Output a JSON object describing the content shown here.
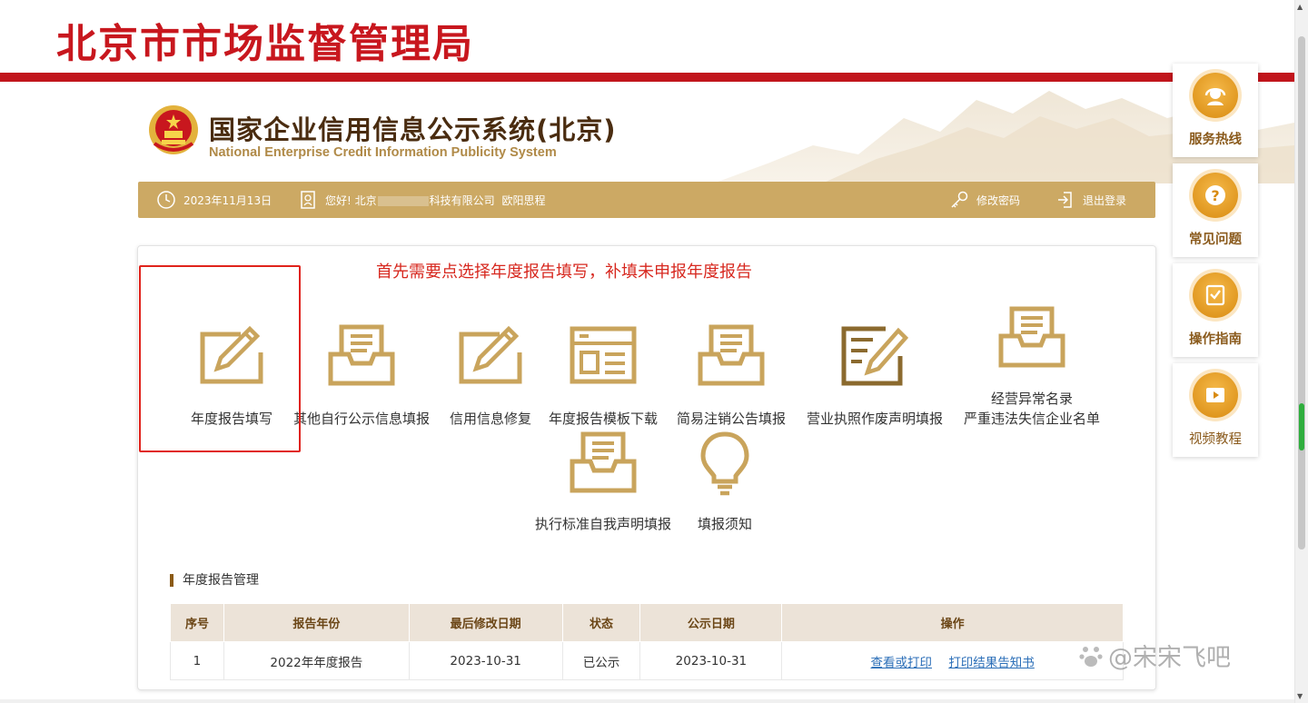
{
  "bureau": {
    "title": "北京市市场监督管理局"
  },
  "system": {
    "title": "国家企业信用信息公示系统(北京)",
    "subtitle": "National Enterprise Credit Information Publicity System"
  },
  "navbar": {
    "date": "2023年11月13日",
    "greeting": "您好!",
    "company": "北京",
    "company_suffix": "科技有限公司",
    "user": "欧阳思程",
    "change_password": "修改密码",
    "logout": "退出登录"
  },
  "instruction": "首先需要点选择年度报告填写，补填未申报年度报告",
  "tiles": [
    {
      "label": "年度报告填写",
      "icon": "edit-icon"
    },
    {
      "label": "其他自行公示信息填报",
      "icon": "inbox-doc-icon"
    },
    {
      "label": "信用信息修复",
      "icon": "edit-icon"
    },
    {
      "label": "年度报告模板下载",
      "icon": "template-icon"
    },
    {
      "label": "简易注销公告填报",
      "icon": "inbox-doc-icon"
    },
    {
      "label": "营业执照作废声明填报",
      "icon": "license-edit-icon"
    },
    {
      "label": "经营异常名录",
      "label2": "严重违法失信企业名单",
      "icon": "inbox-doc-icon"
    },
    {
      "label": "执行标准自我声明填报",
      "icon": "inbox-doc-icon"
    },
    {
      "label": "填报须知",
      "icon": "lightbulb-icon"
    }
  ],
  "section": {
    "title": "年度报告管理"
  },
  "table": {
    "headers": [
      "序号",
      "报告年份",
      "最后修改日期",
      "状态",
      "公示日期",
      "操作"
    ],
    "rows": [
      {
        "index": "1",
        "year": "2022年年度报告",
        "modified": "2023-10-31",
        "status": "已公示",
        "published": "2023-10-31",
        "op1": "查看或打印",
        "op2": "打印结果告知书"
      }
    ]
  },
  "float_menu": [
    {
      "label": "服务热线",
      "icon": "headset-icon"
    },
    {
      "label": "常见问题",
      "icon": "question-icon"
    },
    {
      "label": "操作指南",
      "icon": "guide-icon"
    },
    {
      "label": "视频教程",
      "icon": "video-icon"
    }
  ],
  "watermark": "@宋宋飞吧",
  "colors": {
    "brand_red": "#c1151c",
    "gold": "#cca964",
    "icon_gold": "#c9a45c",
    "link": "#2c6fb8"
  }
}
